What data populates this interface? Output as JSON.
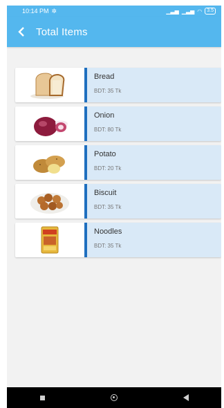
{
  "status_bar": {
    "time": "10:14 PM",
    "battery": "3.5"
  },
  "app_bar": {
    "title": "Total Items"
  },
  "items": [
    {
      "name": "Bread",
      "price": "BDT: 35 Tk",
      "icon": "bread-image"
    },
    {
      "name": "Onion",
      "price": "BDT: 80 Tk",
      "icon": "onion-image"
    },
    {
      "name": "Potato",
      "price": "BDT: 20 Tk",
      "icon": "potato-image"
    },
    {
      "name": "Biscuit",
      "price": "BDT: 35 Tk",
      "icon": "biscuit-image"
    },
    {
      "name": "Noodles",
      "price": "BDT: 35 Tk",
      "icon": "noodles-image"
    }
  ],
  "colors": {
    "app_bar": "#54b7ee",
    "card": "#d9e9f7",
    "accent": "#1f6fbf"
  }
}
